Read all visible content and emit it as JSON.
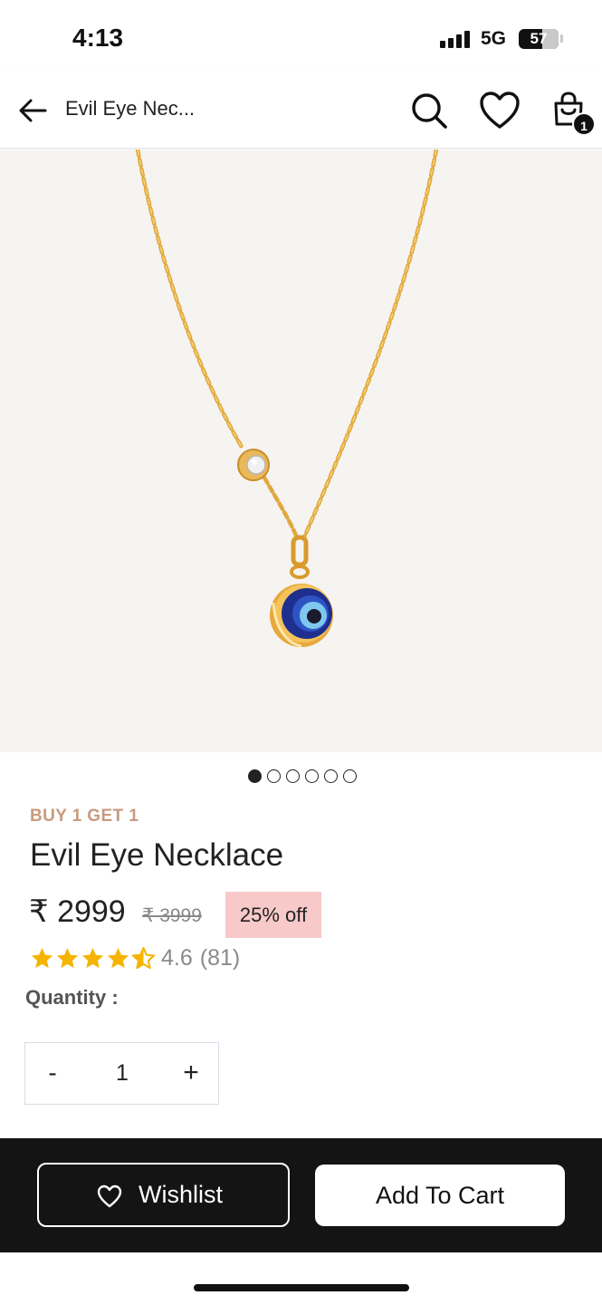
{
  "status_bar": {
    "time": "4:13",
    "network": "5G",
    "battery": "57"
  },
  "header": {
    "title": "Evil Eye Nec...",
    "cart_count": "1",
    "icons": [
      "back-arrow-icon",
      "search-icon",
      "heart-icon",
      "cart-icon"
    ]
  },
  "gallery": {
    "image_alt": "Evil Eye Necklace",
    "total_images": 6,
    "active_index": 0
  },
  "product": {
    "promo_tag": "BUY 1 GET 1",
    "title": "Evil Eye Necklace",
    "price": "₹ 2999",
    "mrp": "₹ 3999",
    "discount": "25% off",
    "rating": 4.6,
    "rating_text": "4.6",
    "review_count": "(81)"
  },
  "quantity": {
    "label": "Quantity :",
    "minus_label": "-",
    "value": "1",
    "plus_label": "+"
  },
  "actions": {
    "wishlist_label": "Wishlist",
    "add_to_cart_label": "Add To Cart"
  },
  "colors": {
    "accent_promo": "#c79b7d",
    "discount_bg": "#f8c9c9",
    "star": "#f5b400",
    "action_bar": "#141414",
    "image_bg": "#f6f4f1"
  }
}
